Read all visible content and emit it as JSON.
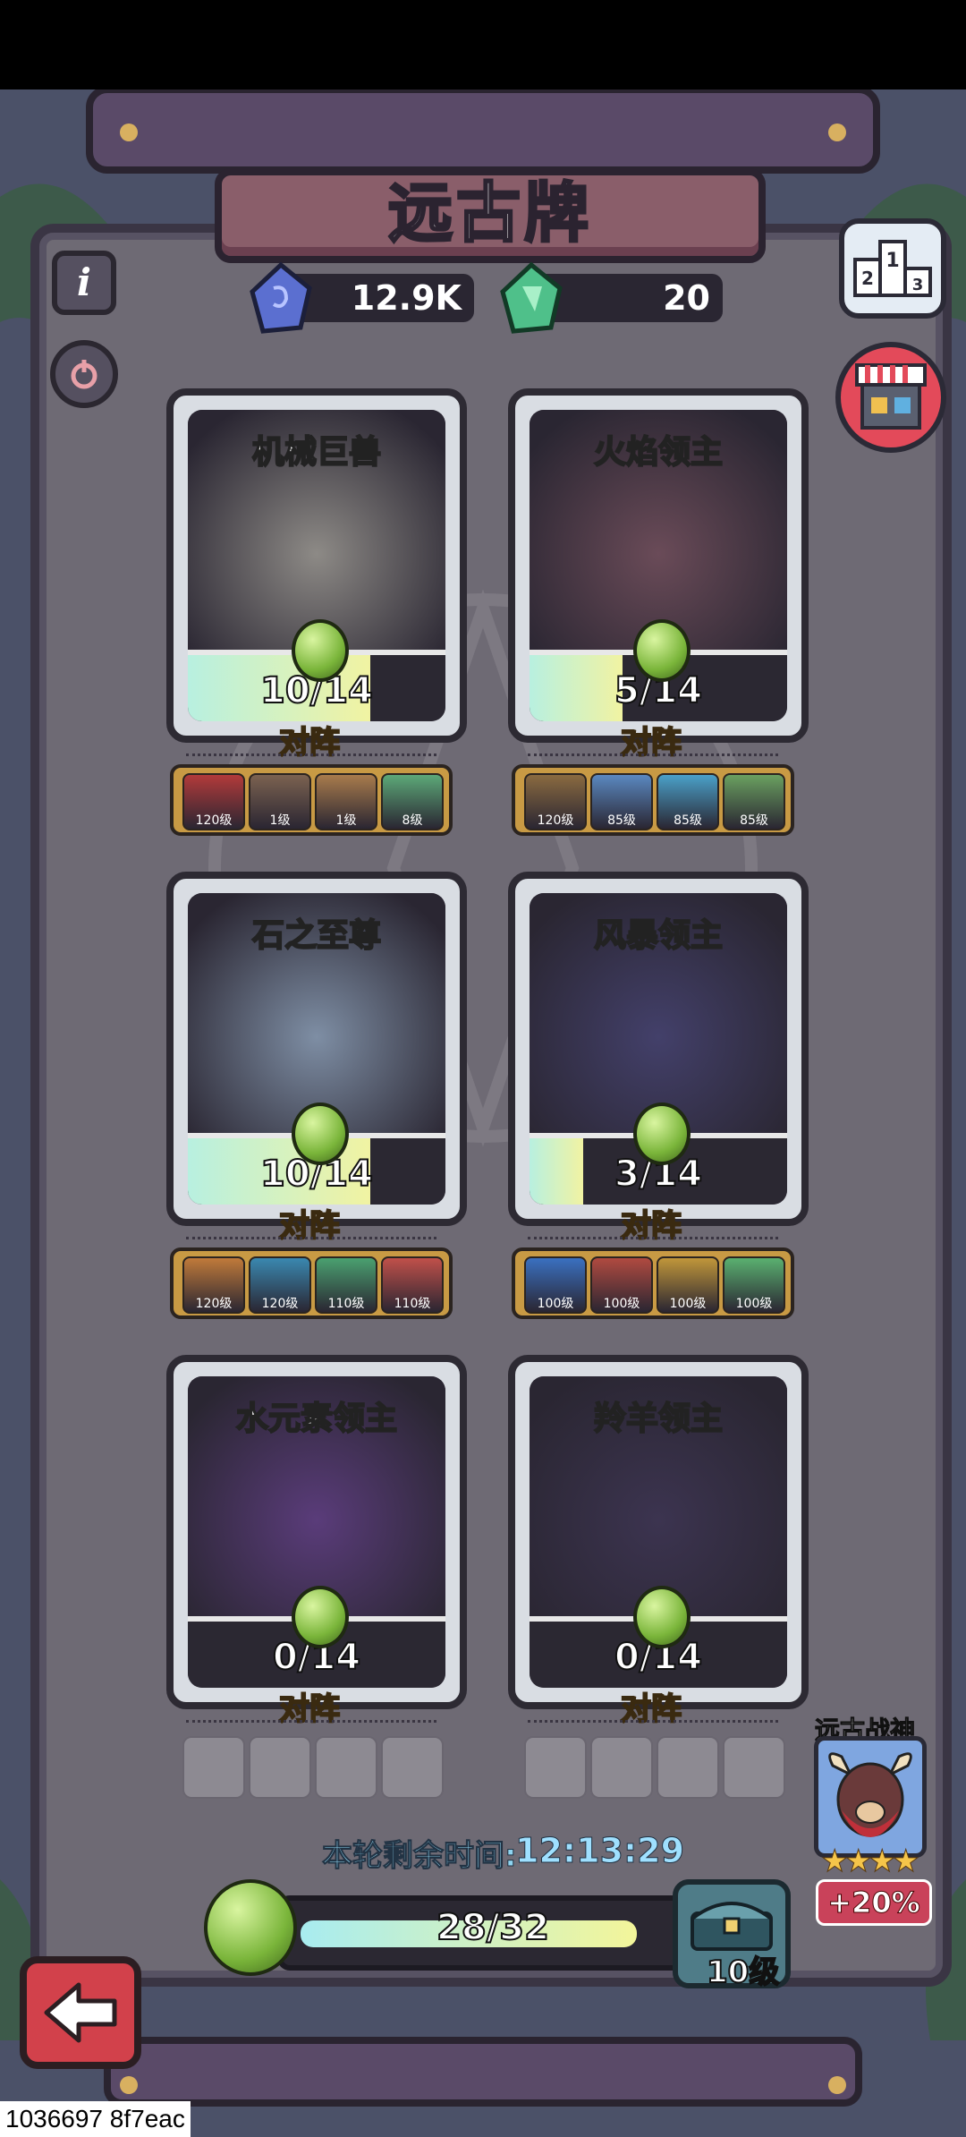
{
  "title": "远古牌",
  "currencies": [
    {
      "icon": "blue-crystal-icon",
      "value": "12.9K"
    },
    {
      "icon": "green-crystal-icon",
      "value": "20"
    }
  ],
  "lineup_label": "对阵",
  "cards": [
    {
      "name": "机械巨兽",
      "progress_text": "10/14",
      "progress": 0.71,
      "art_color": "#8d8a86",
      "heroes": [
        {
          "level": "120级",
          "color": "#b23a3a"
        },
        {
          "level": "1级",
          "color": "#7b6250"
        },
        {
          "level": "1级",
          "color": "#a87b4c"
        },
        {
          "level": "8级",
          "color": "#5ca878"
        }
      ]
    },
    {
      "name": "火焰领主",
      "progress_text": "5/14",
      "progress": 0.36,
      "art_color": "#6a4b58",
      "heroes": [
        {
          "level": "120级",
          "color": "#8a6a40"
        },
        {
          "level": "85级",
          "color": "#5a88c0"
        },
        {
          "level": "85级",
          "color": "#4aa0c8"
        },
        {
          "level": "85级",
          "color": "#6aa060"
        }
      ]
    },
    {
      "name": "石之至尊",
      "progress_text": "10/14",
      "progress": 0.71,
      "art_color": "#7e8ea4",
      "heroes": [
        {
          "level": "120级",
          "color": "#c07a3a"
        },
        {
          "level": "120级",
          "color": "#3a88b0"
        },
        {
          "level": "110级",
          "color": "#4aa070"
        },
        {
          "level": "110级",
          "color": "#c0504a"
        }
      ]
    },
    {
      "name": "风暴领主",
      "progress_text": "3/14",
      "progress": 0.21,
      "art_color": "#43406a",
      "heroes": [
        {
          "level": "100级",
          "color": "#3a70c0"
        },
        {
          "level": "100级",
          "color": "#b04a40"
        },
        {
          "level": "100级",
          "color": "#c0963a"
        },
        {
          "level": "100级",
          "color": "#5ab070"
        }
      ]
    },
    {
      "name": "水元素领主",
      "progress_text": "0/14",
      "progress": 0,
      "art_color": "#5a3c7a",
      "heroes": []
    },
    {
      "name": "羚羊领主",
      "progress_text": "0/14",
      "progress": 0,
      "art_color": "#3c3450",
      "heroes": []
    }
  ],
  "timer": {
    "label": "本轮剩余时间:",
    "value": "12:13:29"
  },
  "xp": {
    "text": "28/32",
    "progress": 0.875,
    "level": "10级"
  },
  "god": {
    "name": "远古战神",
    "stars": "★★★★",
    "bonus": "+20%"
  },
  "build_id": "1036697 8f7eac",
  "colors": {
    "panel": "#6e6a74",
    "frame": "#4b5168",
    "lineup_gold": "#c89a44",
    "back_red": "#d2414b"
  }
}
